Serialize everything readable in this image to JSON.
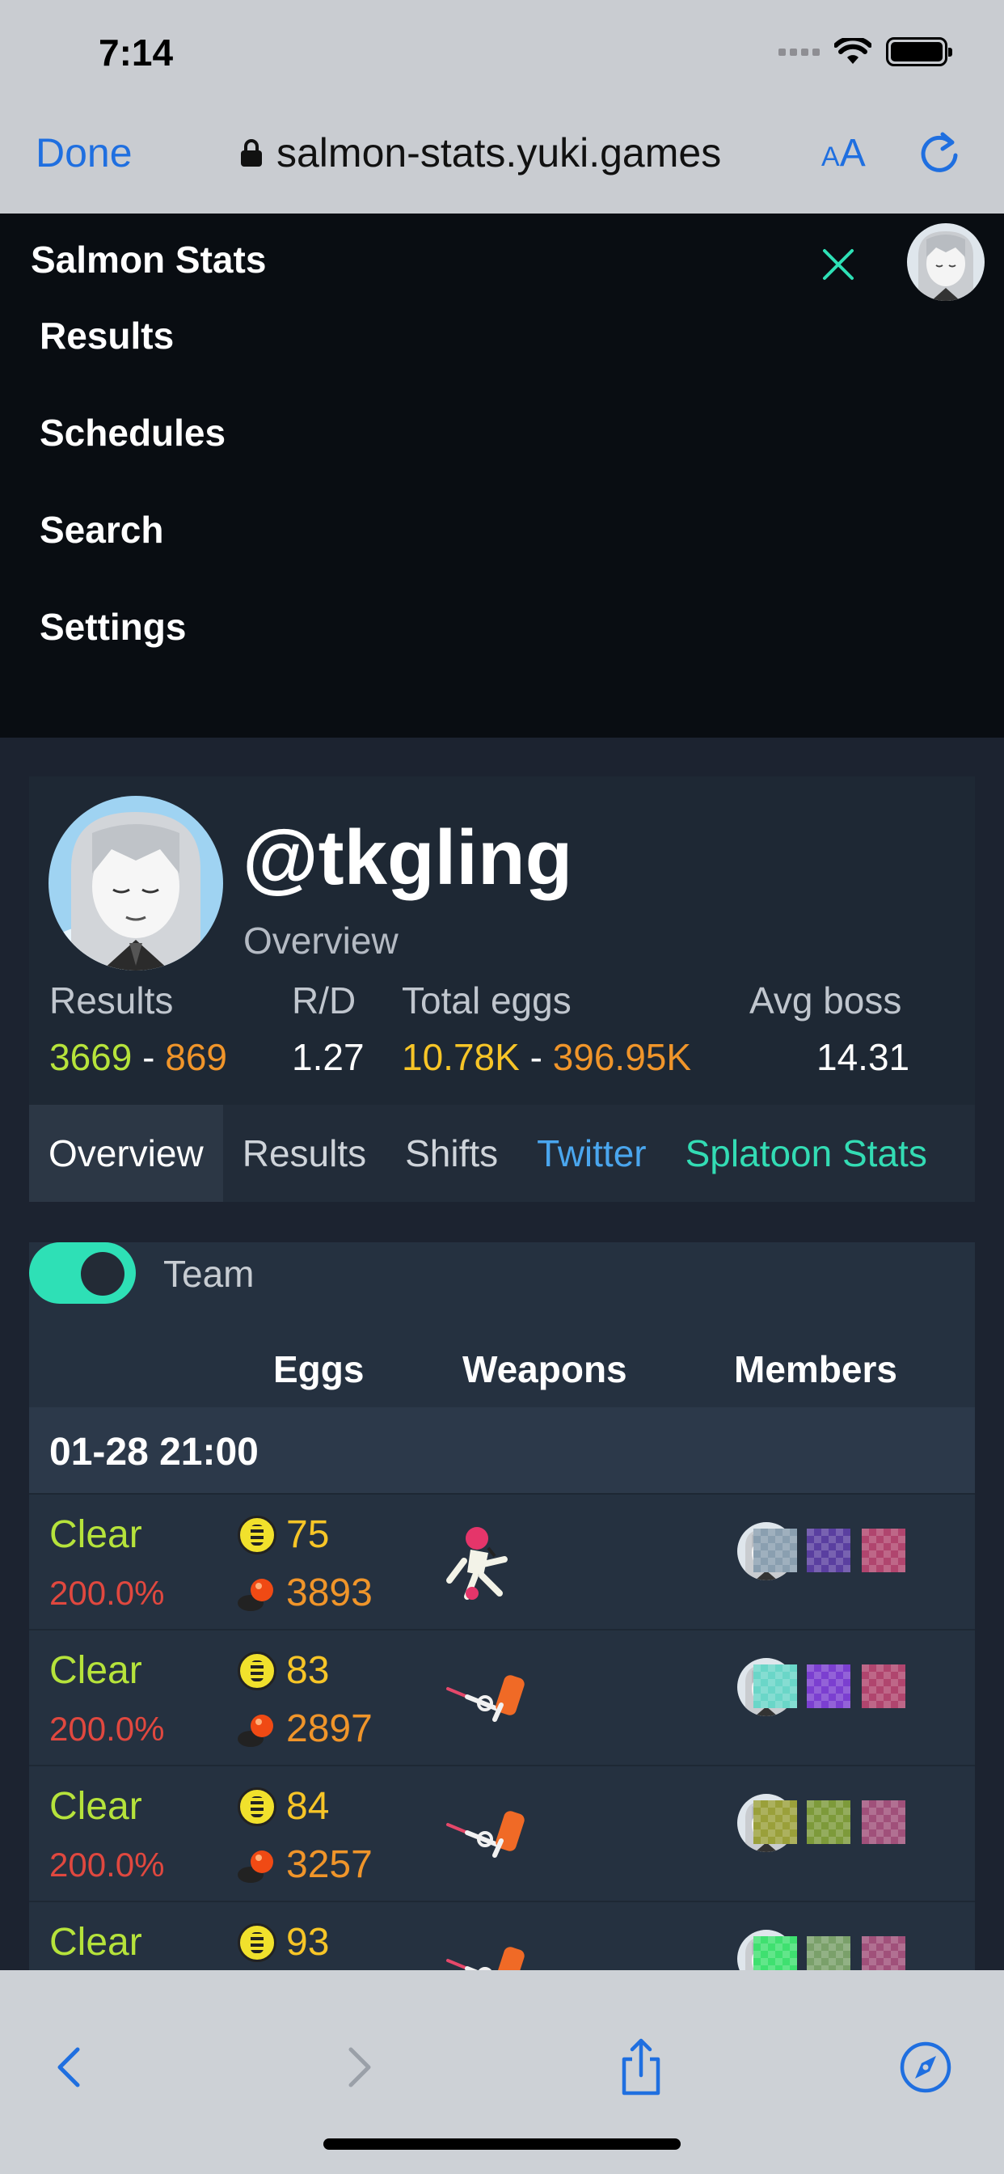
{
  "status_bar": {
    "time": "7:14"
  },
  "browser": {
    "done_label": "Done",
    "url": "salmon-stats.yuki.games",
    "aa_small": "A",
    "aa_big": "A",
    "accent": "#1f6fe0"
  },
  "nav": {
    "brand": "Salmon Stats",
    "menu": [
      "Results",
      "Schedules",
      "Search",
      "Settings"
    ]
  },
  "profile": {
    "username": "@tkgling",
    "subtitle": "Overview",
    "stats": {
      "results_label": "Results",
      "results_clear": "3669",
      "results_sep": "-",
      "results_fail": "869",
      "rd_label": "R/D",
      "rd_value": "1.27",
      "eggs_label": "Total eggs",
      "eggs_golden": "10.78K",
      "eggs_sep": "-",
      "eggs_power": "396.95K",
      "boss_label": "Avg boss",
      "boss_value": "14.31"
    },
    "tabs": [
      "Overview",
      "Results",
      "Shifts",
      "Twitter",
      "Splatoon Stats"
    ]
  },
  "results": {
    "toggle_label": "Team",
    "toggle_on": true,
    "columns": [
      "Eggs",
      "Weapons",
      "Members"
    ],
    "date": "01-28 21:00",
    "rows": [
      {
        "status": "Clear",
        "danger": "200.0%",
        "golden": "75",
        "power": "3893",
        "weapon": "charger-icon",
        "members": [
          "#8a9fb0",
          "#5a3fa0",
          "#b0456e"
        ]
      },
      {
        "status": "Clear",
        "danger": "200.0%",
        "golden": "83",
        "power": "2897",
        "weapon": "roller-icon",
        "members": [
          "#6ad6c8",
          "#7b3fd0",
          "#b0456e"
        ]
      },
      {
        "status": "Clear",
        "danger": "200.0%",
        "golden": "84",
        "power": "3257",
        "weapon": "roller-icon",
        "members": [
          "#9aa03a",
          "#7d9a3a",
          "#a0507a"
        ]
      },
      {
        "status": "Clear",
        "danger": "",
        "golden": "93",
        "power": "",
        "weapon": "roller-icon",
        "members": [
          "#3fe070",
          "#7aa06a",
          "#a0507a"
        ]
      }
    ]
  },
  "colors": {
    "clear": "#b6e33b",
    "danger": "#e0483f",
    "golden": "#f7c527",
    "power": "#f0952a",
    "teal": "#2ee0b6"
  }
}
